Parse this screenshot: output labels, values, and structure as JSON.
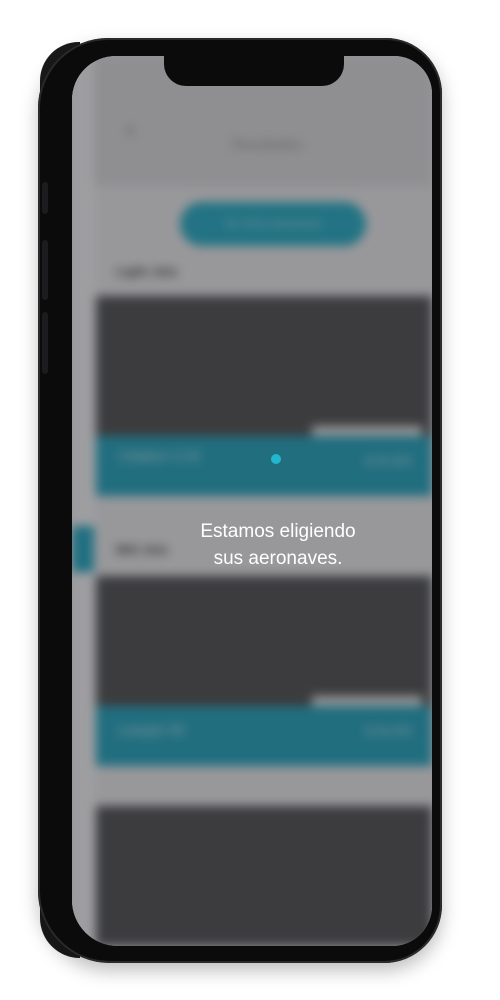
{
  "screen": {
    "header_title": "Resultados",
    "filter_button": "Ver otras aeronaves",
    "sections": [
      {
        "label": "Light Jets"
      },
      {
        "label": "Mid Jets"
      }
    ],
    "cards": [
      {
        "name": "Citation CJ3",
        "price": "$ 00,000"
      },
      {
        "name": "Learjet 45",
        "price": "$ 00,000"
      }
    ]
  },
  "overlay": {
    "loading_line1": "Estamos eligiendo",
    "loading_line2": "sus aeronaves."
  },
  "colors": {
    "accent": "#1fa9c4",
    "spinner": "#22b6cf",
    "phone_frame": "#0b0b0c"
  },
  "icons": [
    "back-chevron-icon",
    "spinner-icon"
  ]
}
